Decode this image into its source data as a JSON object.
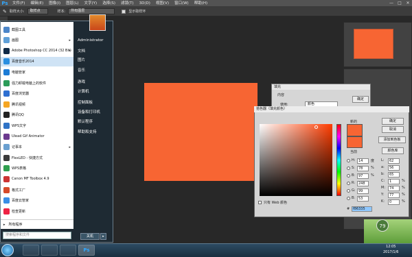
{
  "menubar": {
    "logo": "Ps",
    "items": [
      "文件(F)",
      "编辑(E)",
      "图像(I)",
      "图层(L)",
      "文字(Y)",
      "选择(S)",
      "滤镜(T)",
      "3D(D)",
      "视图(V)",
      "窗口(W)",
      "帮助(H)"
    ],
    "win_min": "—",
    "win_max": "□",
    "win_close": "✕"
  },
  "options": {
    "sample_size_label": "取样大小:",
    "sample_size_value": "取样点",
    "sample_label": "样本:",
    "sample_value": "所有图层",
    "show_ring": "显示取样环"
  },
  "startmenu": {
    "items": [
      {
        "label": "截图工具",
        "color": "#4c86c9",
        "arrow": false
      },
      {
        "label": "画图",
        "color": "#5fa0d8",
        "arrow": true
      },
      {
        "label": "Adobe Photoshop CC 2014 (32 Bit)",
        "color": "#0f2a47",
        "arrow": true
      },
      {
        "label": "百度音乐2014",
        "color": "#2a8fe0",
        "arrow": false,
        "selected": true
      },
      {
        "label": "电脑管家",
        "color": "#1c7cd6",
        "arrow": false
      },
      {
        "label": "强力卸载电脑上的软件",
        "color": "#2b9c59",
        "arrow": false
      },
      {
        "label": "百度浏览器",
        "color": "#2d6fd1",
        "arrow": false
      },
      {
        "label": "腾讯视频",
        "color": "#f5a623",
        "arrow": false
      },
      {
        "label": "腾讯QQ",
        "color": "#222222",
        "arrow": false
      },
      {
        "label": "WPS文字",
        "color": "#2f73c6",
        "arrow": false
      },
      {
        "label": "Ulead Gif Animator",
        "color": "#6b3a8f",
        "arrow": false
      },
      {
        "label": "记事本",
        "color": "#6aa0d0",
        "arrow": true
      },
      {
        "label": "FlexLED - 快捷方式",
        "color": "#3a3a3a",
        "arrow": false
      },
      {
        "label": "WPS表格",
        "color": "#2f9f4f",
        "arrow": false
      },
      {
        "label": "Canon MF Toolbox 4.9",
        "color": "#c33",
        "arrow": false
      },
      {
        "label": "格式工厂",
        "color": "#d64a2a",
        "arrow": false
      },
      {
        "label": "百度云管家",
        "color": "#3a8ee6",
        "arrow": false
      },
      {
        "label": "检查更新",
        "color": "#e24",
        "arrow": false
      }
    ],
    "all_programs": "所有程序",
    "search_placeholder": "搜索程序和文件",
    "right": [
      "Administrator",
      "文档",
      "图片",
      "音乐",
      "游戏",
      "计算机",
      "控制面板",
      "设备和打印机",
      "默认程序",
      "帮助和支持"
    ],
    "shutdown": "关机",
    "shutdown_arrow": "▸"
  },
  "fill_dialog": {
    "title": "填充",
    "content_label": "内容",
    "use_label": "使用:",
    "use_value": "颜色",
    "ok": "确定"
  },
  "picker": {
    "title": "拾色器（填充颜色）",
    "new_label": "新的",
    "current_label": "当前",
    "ok": "确定",
    "cancel": "取消",
    "add_swatch": "添加到色板",
    "libraries": "颜色库",
    "web_only": "只有 Web 颜色",
    "fields": [
      {
        "k": "H:",
        "v": "14",
        "u": "度"
      },
      {
        "k": "S:",
        "v": "78",
        "u": "%"
      },
      {
        "k": "B:",
        "v": "97",
        "u": "%"
      },
      {
        "k": "R:",
        "v": "248",
        "u": ""
      },
      {
        "k": "G:",
        "v": "99",
        "u": ""
      },
      {
        "k": "B:",
        "v": "53",
        "u": ""
      }
    ],
    "lab": [
      {
        "k": "L:",
        "v": "62"
      },
      {
        "k": "a:",
        "v": "56"
      },
      {
        "k": "b:",
        "v": "65"
      }
    ],
    "cmyk": [
      {
        "k": "C:",
        "v": "1",
        "u": "%"
      },
      {
        "k": "M:",
        "v": "74",
        "u": "%"
      },
      {
        "k": "Y:",
        "v": "77",
        "u": "%"
      },
      {
        "k": "K:",
        "v": "0",
        "u": "%"
      }
    ],
    "hex_label": "#",
    "hex": "f86335",
    "color": "#f76533"
  },
  "taskbar": {
    "time": "12:05",
    "date": "2017/1/6",
    "badge": "79"
  }
}
